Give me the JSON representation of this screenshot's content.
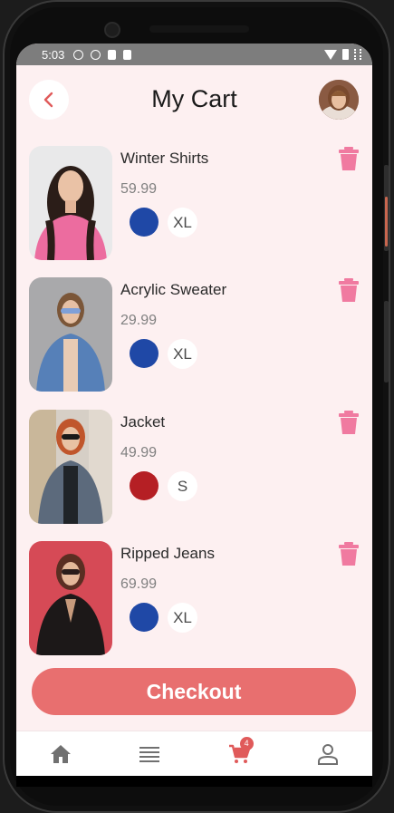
{
  "status_bar": {
    "time": "5:03",
    "icons": [
      "info-icon",
      "shield-icon",
      "sd-card-icon",
      "a-icon",
      "wifi-icon",
      "battery-icon",
      "signal-icon"
    ]
  },
  "header": {
    "title": "My Cart",
    "back_icon": "chevron-left-icon"
  },
  "cart": {
    "items": [
      {
        "name": "Winter Shirts",
        "price": "59.99",
        "color": "#1f48a6",
        "size": "XL"
      },
      {
        "name": "Acrylic Sweater",
        "price": "29.99",
        "color": "#1f48a6",
        "size": "XL"
      },
      {
        "name": "Jacket",
        "price": "49.99",
        "color": "#b51f24",
        "size": "S"
      },
      {
        "name": "Ripped Jeans",
        "price": "69.99",
        "color": "#1f48a6",
        "size": "XL"
      }
    ],
    "delete_icon": "trash-icon"
  },
  "checkout": {
    "label": "Checkout"
  },
  "bottom_nav": {
    "items": [
      "home-icon",
      "list-icon",
      "cart-icon",
      "profile-icon"
    ],
    "cart_badge": "4",
    "active": "cart-icon"
  },
  "colors": {
    "accent": "#e86f6f",
    "trash": "#f07aa0",
    "background": "#fdf0f1"
  }
}
